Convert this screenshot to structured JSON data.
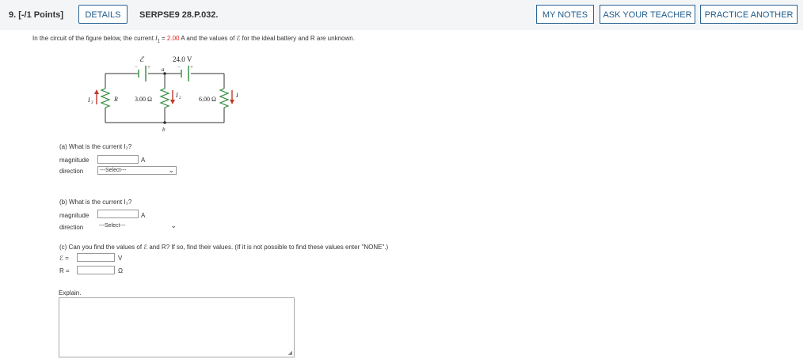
{
  "header": {
    "question_number": "9. [-/1 Points]",
    "details_label": "DETAILS",
    "question_code": "SERPSE9 28.P.032.",
    "my_notes_label": "MY NOTES",
    "ask_teacher_label": "ASK YOUR TEACHER",
    "practice_label": "PRACTICE ANOTHER"
  },
  "problem": {
    "text_before": "In the circuit of the figure below, the current ",
    "i1_symbol": "I",
    "i1_sub": "1",
    "equals": " = ",
    "current_value": "2.00",
    "text_after": " A and the values of ℰ for the ideal battery and R are unknown."
  },
  "figure": {
    "emf_label": "ℰ",
    "voltage_label": "24.0 V",
    "node_a": "a",
    "node_b": "b",
    "r_label": "R",
    "res1_label": "3.00 Ω",
    "res2_label": "6.00 Ω",
    "i1": "I",
    "i1_sub": "1",
    "i2": "I",
    "i2_sub": "2",
    "i3": "I",
    "i3_sub": "3",
    "plus": "+",
    "minus": "−"
  },
  "part_a": {
    "question": "(a) What is the current I₂?",
    "magnitude_label": "magnitude",
    "unit": "A",
    "direction_label": "direction",
    "direction_value": "---Select---"
  },
  "part_b": {
    "question": "(b) What is the current I₃?",
    "magnitude_label": "magnitude",
    "unit": "A",
    "direction_label": "direction",
    "direction_value": "---Select---"
  },
  "part_c": {
    "question": "(c) Can you find the values of ℰ and R? If so, find their values. (If it is not possible to find these values enter \"NONE\".)",
    "emf_label": "ℰ =",
    "emf_unit": "V",
    "r_label": "R =",
    "r_unit": "Ω"
  },
  "explain_label": "Explain."
}
